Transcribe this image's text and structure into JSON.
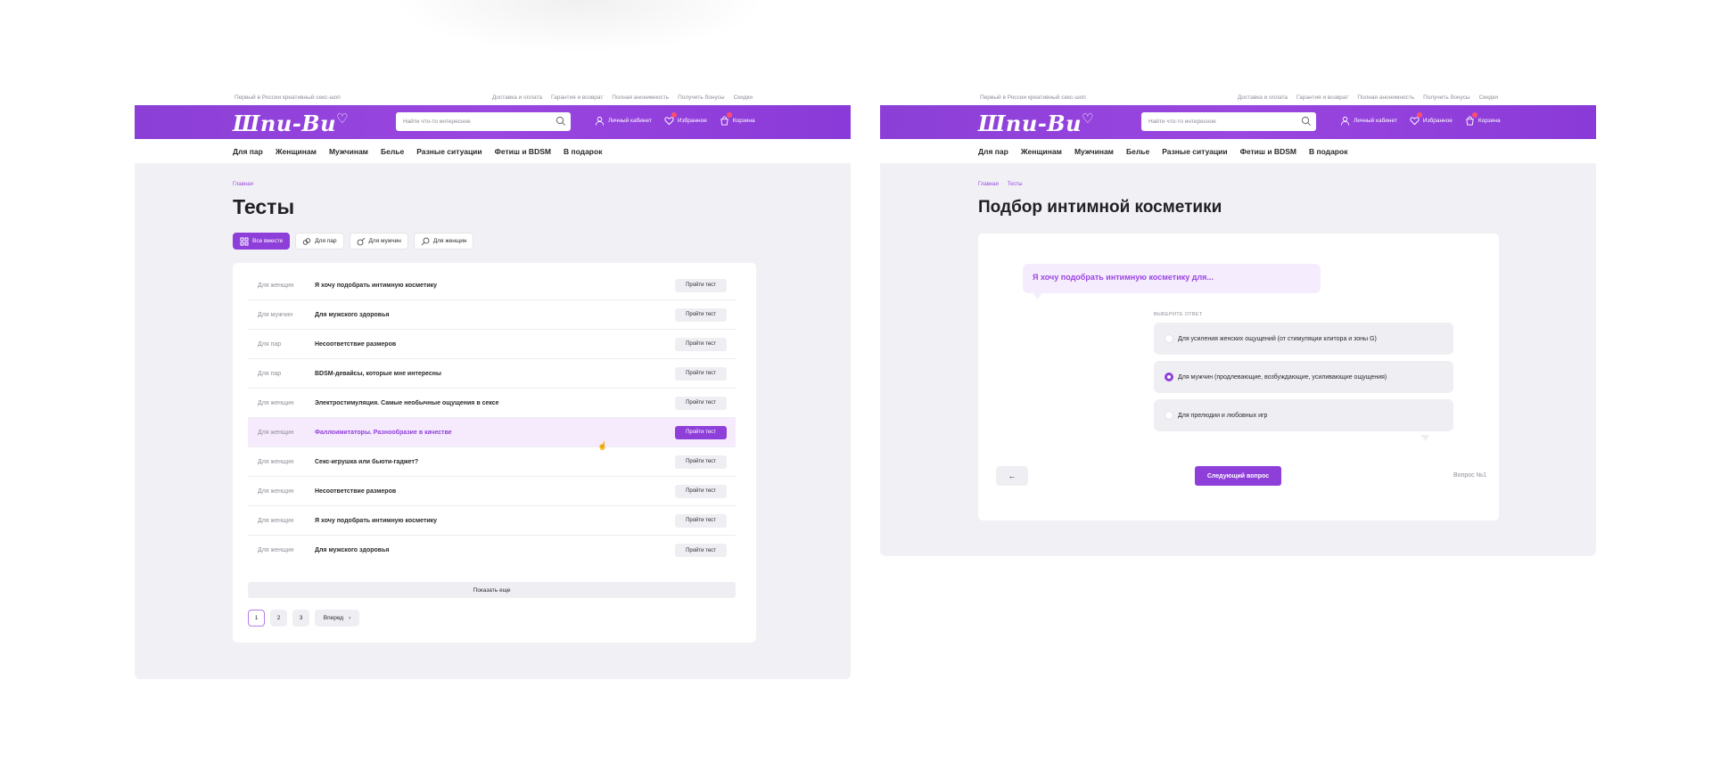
{
  "site": {
    "tagline": "Первый в России креативный секс-шоп",
    "top_links": [
      "Доставка и оплата",
      "Гарантия и возврат",
      "Полная анонимность",
      "Получить бонусы",
      "Скидки"
    ],
    "logo": "Шпu-Ви",
    "search_placeholder": "Найти что-то интересное",
    "actions": [
      "Личный кабинет",
      "Избранное",
      "Корзина"
    ],
    "nav": [
      "Для пар",
      "Женщинам",
      "Мужчинам",
      "Белье",
      "Разные ситуации",
      "Фетиш и BDSM",
      "В подарок"
    ],
    "accent": "#8f3fd9"
  },
  "left": {
    "breadcrumbs": [
      "Главная"
    ],
    "title": "Тесты",
    "filters": [
      "Все вместе",
      "Для пар",
      "Для мужчин",
      "Для женщин"
    ],
    "tests": [
      {
        "category": "Для женщин",
        "name": "Я хочу подобрать интимную косметику",
        "button": "Пройти тест"
      },
      {
        "category": "Для мужчин",
        "name": "Для мужского здоровья",
        "button": "Пройти тест"
      },
      {
        "category": "Для пар",
        "name": "Несоответствие размеров",
        "button": "Пройти тест"
      },
      {
        "category": "Для пар",
        "name": "BDSM-девайсы, которые мне интересны",
        "button": "Пройти тест"
      },
      {
        "category": "Для женщин",
        "name": "Электростимуляция. Самые необычные ощущения в сексе",
        "button": "Пройти тест"
      },
      {
        "category": "Для женщин",
        "name": "Фаллоимитаторы. Разнообразие в качестве",
        "button": "Пройти тест"
      },
      {
        "category": "Для женщин",
        "name": "Секс-игрушка или бьюти-гаджет?",
        "button": "Пройти тест"
      },
      {
        "category": "Для женщин",
        "name": "Несоответствие размеров",
        "button": "Пройти тест"
      },
      {
        "category": "Для женщин",
        "name": "Я хочу подобрать интимную косметику",
        "button": "Пройти тест"
      },
      {
        "category": "Для женщин",
        "name": "Для мужского здоровья",
        "button": "Пройти тест"
      }
    ],
    "show_more": "Показать еще",
    "pages": [
      "1",
      "2",
      "3"
    ],
    "next_page": "Вперед"
  },
  "right": {
    "breadcrumbs": [
      "Главная",
      "Тесты"
    ],
    "title": "Подбор интимной косметики",
    "question": "Я хочу подобрать интимную косметику для...",
    "answer_label": "ВЫБЕРИТЕ ОТВЕТ",
    "options": [
      "Для усиления женских ощущений (от стимуляции клитора и зоны G)",
      "Для мужчин (продлевающие, возбуждающие, усиливающие ощущения)",
      "Для прелюдии и любовных игр"
    ],
    "selected_option": 1,
    "next_button": "Следующий вопрос",
    "question_number": "Вопрос №1"
  }
}
